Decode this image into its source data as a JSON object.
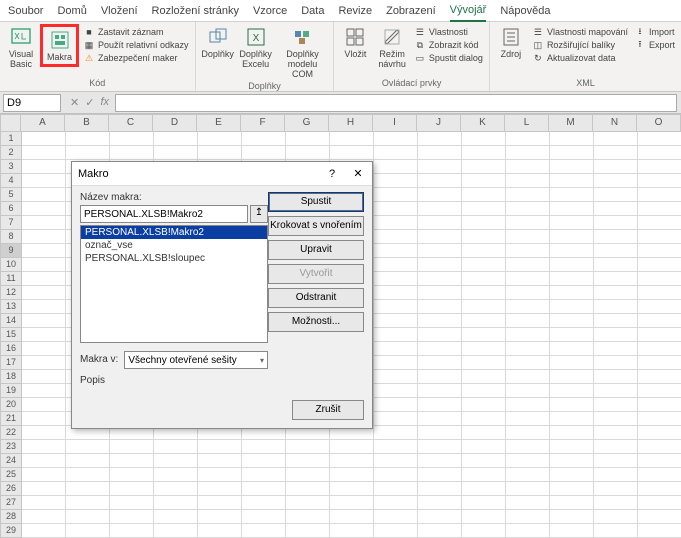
{
  "tabs": [
    "Soubor",
    "Domů",
    "Vložení",
    "Rozložení stránky",
    "Vzorce",
    "Data",
    "Revize",
    "Zobrazení",
    "Vývojář",
    "Nápověda"
  ],
  "active_tab": "Vývojář",
  "ribbon": {
    "kod": {
      "visual_basic": "Visual\nBasic",
      "makra": "Makra",
      "zastavit": "Zastavit záznam",
      "relativni": "Použít relativní odkazy",
      "zabezpeceni": "Zabezpečení maker",
      "label": "Kód"
    },
    "doplnky": {
      "doplnky": "Doplňky",
      "excel": "Doplňky\nExcelu",
      "com": "Doplňky\nmodelu COM",
      "label": "Doplňky"
    },
    "ovladaci": {
      "vlozit": "Vložit",
      "rezim": "Režim\nnávrhu",
      "vlastnosti": "Vlastnosti",
      "zobrazit": "Zobrazit kód",
      "spustit": "Spustit dialog",
      "label": "Ovládací prvky"
    },
    "xml": {
      "zdroj": "Zdroj",
      "mapovani": "Vlastnosti mapování",
      "baliky": "Rozšiřující balíky",
      "aktualizovat": "Aktualizovat data",
      "import": "Import",
      "export": "Export",
      "label": "XML"
    }
  },
  "namebox": "D9",
  "columns": [
    "A",
    "B",
    "C",
    "D",
    "E",
    "F",
    "G",
    "H",
    "I",
    "J",
    "K",
    "L",
    "M",
    "N",
    "O"
  ],
  "dialog": {
    "title": "Makro",
    "name_label": "Název makra:",
    "name_value": "PERSONAL.XLSB!Makro2",
    "list": [
      "PERSONAL.XLSB!Makro2",
      "označ_vse",
      "PERSONAL.XLSB!sloupec"
    ],
    "makra_v_label": "Makra v:",
    "makra_v_value": "Všechny otevřené sešity",
    "popis_label": "Popis",
    "buttons": {
      "spustit": "Spustit",
      "krokovat": "Krokovat s vnořením",
      "upravit": "Upravit",
      "vytvorit": "Vytvořit",
      "odstranit": "Odstranit",
      "moznosti": "Možnosti...",
      "zrusit": "Zrušit"
    }
  }
}
